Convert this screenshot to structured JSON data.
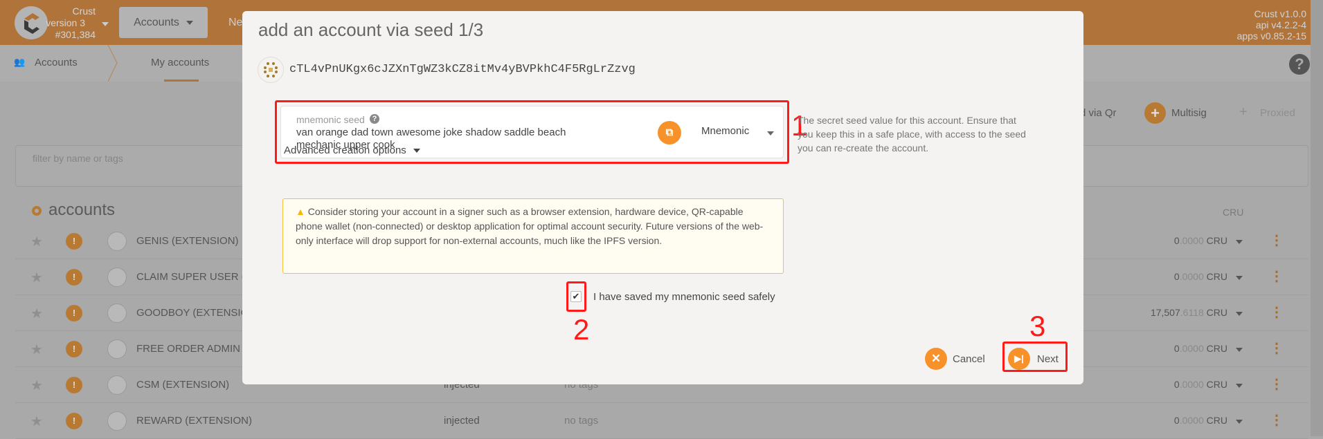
{
  "header": {
    "chain_name": "Crust",
    "chain_version": "version 3",
    "block": "#301,384",
    "nav_dropdown": "Accounts",
    "nav_partial": "Ne",
    "versions": [
      "Crust v1.0.0",
      "api v4.2.2-4",
      "apps v0.85.2-15"
    ]
  },
  "subnav": {
    "section": "Accounts",
    "tab": "My accounts"
  },
  "actions": {
    "qr_partial": "d via Qr",
    "multisig": "Multisig",
    "proxied": "Proxied"
  },
  "filter": {
    "placeholder": "filter by name or tags"
  },
  "accounts": {
    "heading": "accounts",
    "balance_header": "CRU",
    "rows": [
      {
        "name": "GENIS (EXTENSION)",
        "type": "",
        "tags": "",
        "int": "0",
        "dec": ".0000",
        "unit": "CRU"
      },
      {
        "name": "CLAIM SUPER USER (E",
        "type": "",
        "tags": "",
        "int": "0",
        "dec": ".0000",
        "unit": "CRU"
      },
      {
        "name": "GOODBOY (EXTENSIO",
        "type": "",
        "tags": "",
        "int": "17,507",
        "dec": ".6118",
        "unit": "CRU"
      },
      {
        "name": "FREE ORDER ADMIN (",
        "type": "",
        "tags": "",
        "int": "0",
        "dec": ".0000",
        "unit": "CRU"
      },
      {
        "name": "CSM (EXTENSION)",
        "type": "injected",
        "tags": "no tags",
        "int": "0",
        "dec": ".0000",
        "unit": "CRU"
      },
      {
        "name": "REWARD (EXTENSION)",
        "type": "injected",
        "tags": "no tags",
        "int": "0",
        "dec": ".0000",
        "unit": "CRU"
      }
    ]
  },
  "modal": {
    "title": "add an account via seed 1/3",
    "address": "cTL4vPnUKgx6cJZXnTgWZ3kCZ8itMv4yBVPkhC4F5RgLrZzvg",
    "seed_label": "mnemonic seed",
    "seed_value": "van orange dad town awesome joke shadow saddle beach mechanic upper cook",
    "seed_type": "Mnemonic",
    "seed_help": "The secret seed value for this account. Ensure that you keep this in a safe place, with access to the seed you can re-create the account.",
    "advanced": "Advanced creation options",
    "warning": "Consider storing your account in a signer such as a browser extension, hardware device, QR-capable phone wallet (non-connected) or desktop application for optimal account security. Future versions of the web-only interface will drop support for non-external accounts, much like the IPFS version.",
    "confirm": "I have saved my mnemonic seed safely",
    "confirm_checked": true,
    "cancel": "Cancel",
    "next": "Next"
  },
  "annotations": [
    "1",
    "2",
    "3"
  ]
}
